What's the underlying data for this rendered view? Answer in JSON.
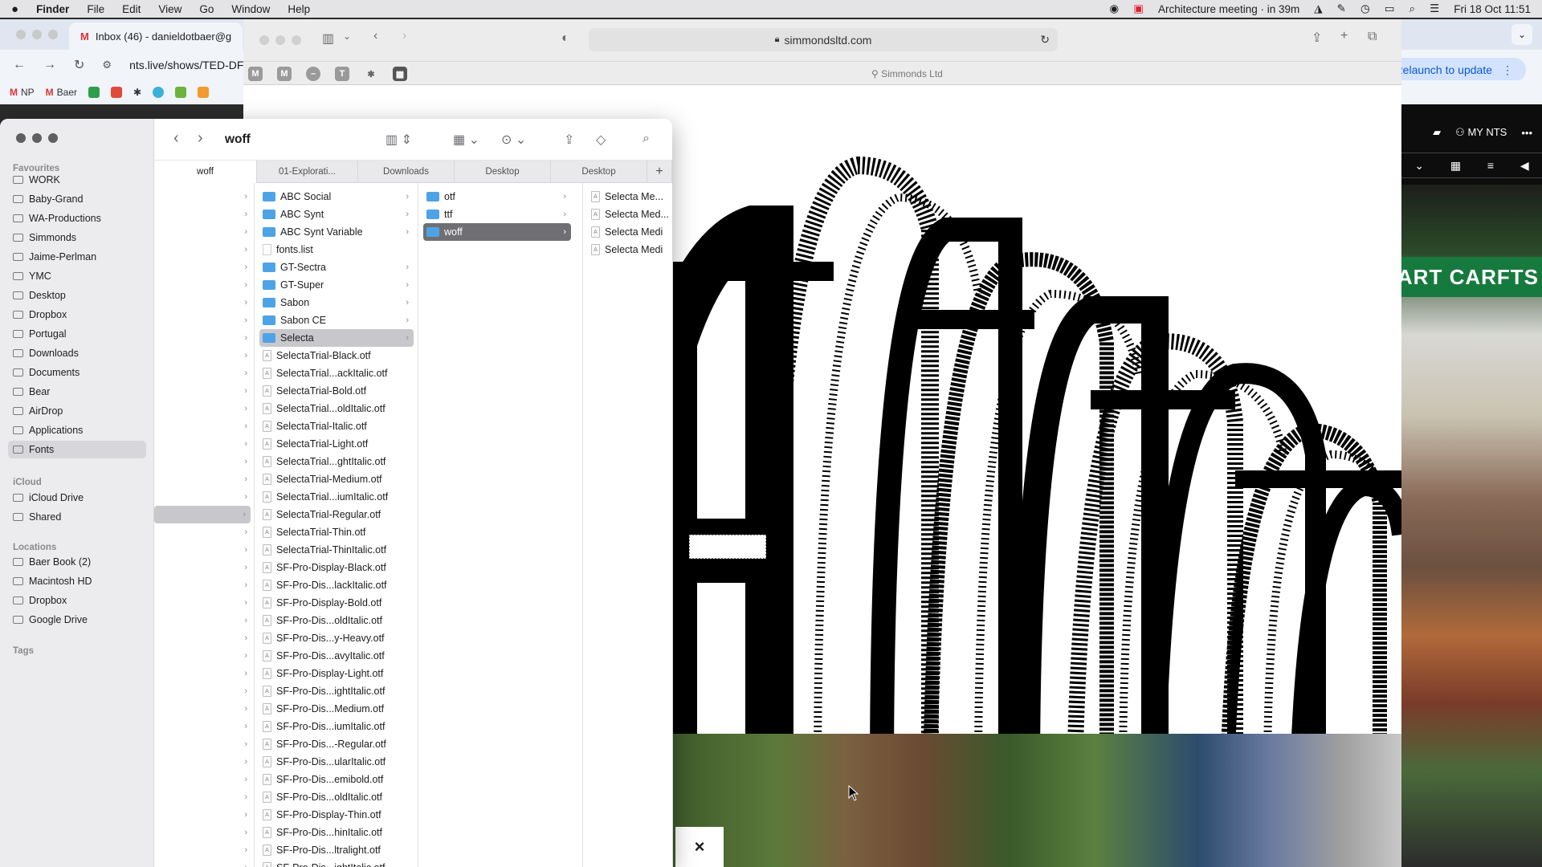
{
  "menubar": {
    "apple": "",
    "items": [
      "Finder",
      "File",
      "Edit",
      "View",
      "Go",
      "Window",
      "Help"
    ],
    "meeting": "Architecture meeting · in 39m",
    "datetime": "Fri 18 Oct  11:51"
  },
  "chrome": {
    "tab_title": "Inbox (46) - danieldotbaer@g",
    "url": "nts.live/shows/TED-DF",
    "relaunch_label": "Relaunch to update",
    "bookmarks": [
      "NP",
      "Baer"
    ]
  },
  "safari": {
    "url": "simmondsltd.com",
    "tab_title": "Simmonds Ltd"
  },
  "nts": {
    "my_nts": "MY NTS",
    "sign_text": "S - ART CARFTS"
  },
  "finder": {
    "title": "woff",
    "sidebar": {
      "favourites_header": "Favourites",
      "favourites": [
        "WORK",
        "Baby-Grand",
        "WA-Productions",
        "Simmonds",
        "Jaime-Perlman",
        "YMC",
        "Desktop",
        "Dropbox",
        "Portugal",
        "Downloads",
        "Documents",
        "Bear",
        "AirDrop",
        "Applications",
        "Fonts"
      ],
      "icloud_header": "iCloud",
      "icloud": [
        "iCloud Drive",
        "Shared"
      ],
      "locations_header": "Locations",
      "locations": [
        "Baer Book (2)",
        "Macintosh HD",
        "Dropbox",
        "Google Drive"
      ],
      "tags_header": "Tags"
    },
    "tabs": [
      "woff",
      "01-Explorati...",
      "Downloads",
      "Desktop",
      "Desktop"
    ],
    "col2": [
      "ABC Social",
      "ABC Synt",
      "ABC Synt Variable",
      "fonts.list",
      "GT-Sectra",
      "GT-Super",
      "Sabon",
      "Sabon CE",
      "Selecta",
      "SelectaTrial-Black.otf",
      "SelectaTrial...ackItalic.otf",
      "SelectaTrial-Bold.otf",
      "SelectaTrial...oldItalic.otf",
      "SelectaTrial-Italic.otf",
      "SelectaTrial-Light.otf",
      "SelectaTrial...ghtItalic.otf",
      "SelectaTrial-Medium.otf",
      "SelectaTrial...iumItalic.otf",
      "SelectaTrial-Regular.otf",
      "SelectaTrial-Thin.otf",
      "SelectaTrial-ThinItalic.otf",
      "SF-Pro-Display-Black.otf",
      "SF-Pro-Dis...lackItalic.otf",
      "SF-Pro-Display-Bold.otf",
      "SF-Pro-Dis...oldItalic.otf",
      "SF-Pro-Dis...y-Heavy.otf",
      "SF-Pro-Dis...avyItalic.otf",
      "SF-Pro-Display-Light.otf",
      "SF-Pro-Dis...ightItalic.otf",
      "SF-Pro-Dis...Medium.otf",
      "SF-Pro-Dis...iumItalic.otf",
      "SF-Pro-Dis...-Regular.otf",
      "SF-Pro-Dis...ularItalic.otf",
      "SF-Pro-Dis...emibold.otf",
      "SF-Pro-Dis...oldItalic.otf",
      "SF-Pro-Display-Thin.otf",
      "SF-Pro-Dis...hinItalic.otf",
      "SF-Pro-Dis...ltralight.otf",
      "SF-Pro-Dis...ightItalic.otf"
    ],
    "col3": [
      "otf",
      "ttf",
      "woff"
    ],
    "col4": [
      "Selecta Me...",
      "Selecta Med...",
      "Selecta Medi",
      "Selecta Medi"
    ],
    "close_label": "×"
  },
  "colors": {
    "accent": "#4ea3e6",
    "selection": "#c8c8cc",
    "active_selection": "#707074"
  }
}
